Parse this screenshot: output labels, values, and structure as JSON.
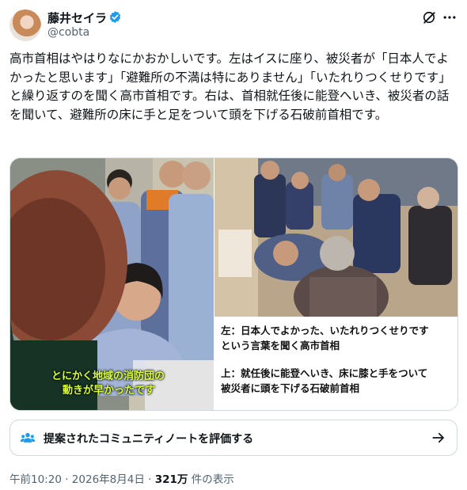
{
  "tweet": {
    "display_name": "藤井セイラ",
    "handle": "@cobta",
    "text": "高市首相はやはりなにかおかしいです。左はイスに座り、被災者が「日本人でよかったと思います」「避難所の不満は特にありません」「いたれりつくせりです」と繰り返すのを聞く高市首相です。右は、首相就任後に能登へいき、被災者の話を聞いて、避難所の床に手と足をついて頭を下げる石破前首相です。"
  },
  "media": {
    "subtitle_line1": "とにかく地域の消防団の",
    "subtitle_line2": "動きが早かったです",
    "caption_left_1": "左：日本人でよかった、いたれりつくせりです",
    "caption_left_2": "という言葉を聞く高市首相",
    "caption_right_1": "上：就任後に能登へいき、床に膝と手をついて",
    "caption_right_2": "被災者に頭を下げる石破前首相"
  },
  "community_note": {
    "label": "提案されたコミュニティノートを評価する"
  },
  "meta": {
    "time": "午前10:20",
    "separator": "·",
    "date": "2026年8月4日",
    "views_count": "321万",
    "views_label": "件の表示"
  },
  "colors": {
    "verified": "#1d9bf0",
    "subtitle": "#d8ff3a",
    "muted": "#536471"
  }
}
